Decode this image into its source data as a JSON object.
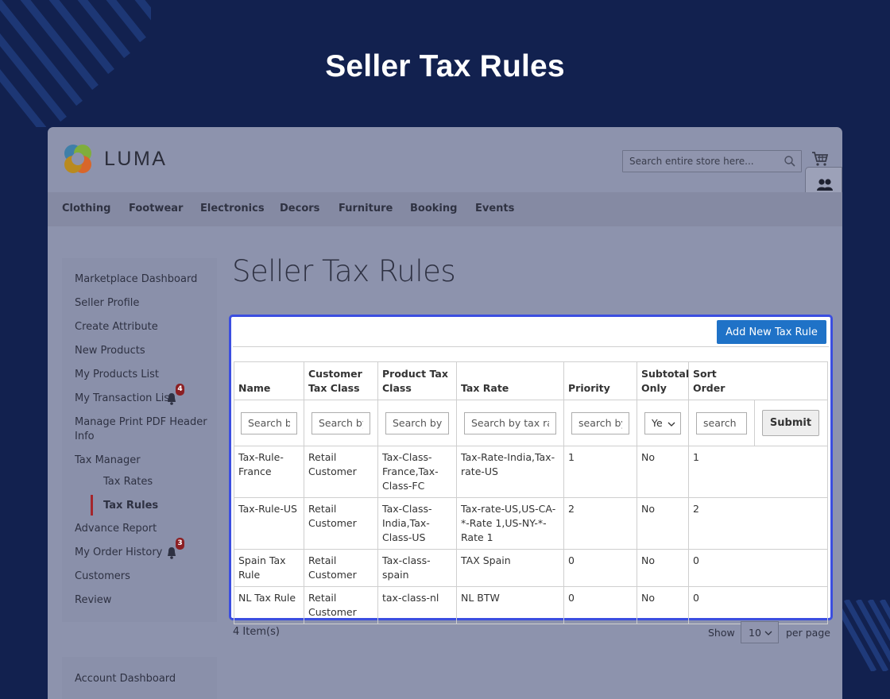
{
  "hero": {
    "title": "Seller Tax Rules"
  },
  "header": {
    "logo_text": "LUMA",
    "search_placeholder": "Search entire store here..."
  },
  "nav": {
    "items": [
      "Clothing",
      "Footwear",
      "Electronics",
      "Decors",
      "Furniture",
      "Booking",
      "Events"
    ]
  },
  "sidebar": {
    "items": {
      "dashboard": "Marketplace Dashboard",
      "profile": "Seller Profile",
      "create_attribute": "Create Attribute",
      "new_products": "New Products",
      "products_list": "My Products List",
      "transaction_list": "My Transaction List",
      "print_pdf": "Manage Print PDF Header Info",
      "tax_manager": "Tax Manager",
      "tax_rates": "Tax Rates",
      "tax_rules": "Tax Rules",
      "advance_report": "Advance Report",
      "order_history": "My Order History",
      "customers": "Customers",
      "review": "Review"
    },
    "badges": {
      "transaction": "4",
      "orders": "3"
    },
    "account_dashboard": "Account Dashboard"
  },
  "main": {
    "page_title": "Seller Tax Rules",
    "add_button": "Add New Tax Rule",
    "columns": {
      "name": "Name",
      "customer_tax_class": "Customer Tax Class",
      "product_tax_class": "Product Tax Class",
      "tax_rate": "Tax Rate",
      "priority": "Priority",
      "subtotal_only": "Subtotal Only",
      "sort_order": "Sort Order"
    },
    "filters": {
      "name": "Search b",
      "customer_tax_class": "Search by",
      "product_tax_class": "Search by p",
      "tax_rate": "Search by tax rat",
      "priority": "search by",
      "subtotal_only": "Ye",
      "sort_order": "search b",
      "submit": "Submit"
    },
    "rows": [
      [
        "Tax-Rule-France",
        "Retail Customer",
        "Tax-Class-France,Tax-Class-FC",
        "Tax-Rate-India,Tax-rate-US",
        "1",
        "No",
        "1"
      ],
      [
        "Tax-Rule-US",
        "Retail Customer",
        "Tax-Class-India,Tax-Class-US",
        "Tax-rate-US,US-CA-*-Rate 1,US-NY-*-Rate 1",
        "2",
        "No",
        "2"
      ],
      [
        "Spain Tax Rule",
        "Retail Customer",
        "Tax-class-spain",
        "TAX Spain",
        "0",
        "No",
        "0"
      ],
      [
        "NL Tax Rule",
        "Retail Customer",
        "tax-class-nl",
        "NL BTW",
        "0",
        "No",
        "0"
      ]
    ],
    "items_count": "4 Item(s)",
    "pager": {
      "show": "Show",
      "per_page_value": "10",
      "per_page": "per page"
    }
  },
  "colors": {
    "background": "#12214f",
    "accent": "#1f72c7",
    "panel_border": "#3b4ee0",
    "badge": "#8b1f23"
  }
}
